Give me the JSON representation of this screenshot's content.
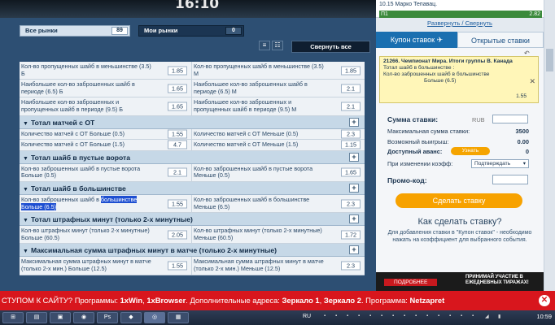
{
  "header": {
    "time": "16:10"
  },
  "filters": {
    "all_markets_label": "Все рынки",
    "all_markets_count": "89",
    "my_markets_label": "Мои рынки",
    "my_markets_count": "0",
    "collapse_all": "Свернуть все"
  },
  "markets": [
    {
      "type": "row",
      "left": {
        "text": "Кол-во пропущенных шайб в меньшинстве (3.5) Б",
        "odd": "1.85"
      },
      "right": {
        "text": "Кол-во пропущенных шайб в меньшинстве (3.5) М",
        "odd": "1.85"
      }
    },
    {
      "type": "row",
      "left": {
        "text": "Наибольшее кол-во заброшенных шайб в периоде (6.5) Б",
        "odd": "1.65"
      },
      "right": {
        "text": "Наибольшее кол-во заброшенных шайб в периоде (6.5) М",
        "odd": "2.1"
      }
    },
    {
      "type": "row",
      "left": {
        "text": "Наибольшее кол-во заброшенных и пропущенных шайб в периоде (9.5) Б",
        "odd": "1.65"
      },
      "right": {
        "text": "Наибольшее кол-во заброшенных и пропущенных шайб в периоде (9.5) М",
        "odd": "2.1"
      }
    },
    {
      "type": "section",
      "title": "Тотал матчей с ОТ"
    },
    {
      "type": "row",
      "left": {
        "text": "Количество матчей с ОТ Больше (0.5)",
        "odd": "1.55"
      },
      "right": {
        "text": "Количество матчей с ОТ Меньше (0.5)",
        "odd": "2.3"
      }
    },
    {
      "type": "row",
      "left": {
        "text": "Количество матчей с ОТ Больше (1.5)",
        "odd": "4.7"
      },
      "right": {
        "text": "Количество матчей с ОТ Меньше (1.5)",
        "odd": "1.15"
      }
    },
    {
      "type": "section",
      "title": "Тотал шайб в пустые ворота"
    },
    {
      "type": "row",
      "left": {
        "text": "Кол-во заброшенных шайб в пустые ворота Больше (0.5)",
        "odd": "2.1"
      },
      "right": {
        "text": "Кол-во заброшенных шайб в пустые ворота Меньше (0.5)",
        "odd": "1.65"
      }
    },
    {
      "type": "section",
      "title": "Тотал шайб в большинстве"
    },
    {
      "type": "row",
      "left": {
        "text": "Кол-во заброшенных шайб в большинстве Больше (6.5)",
        "odd": "1.55",
        "highlight": "большинстве Больше (6.5)"
      },
      "right": {
        "text": "Кол-во заброшенных шайб в большинстве Меньше (6.5)",
        "odd": "2.3"
      }
    },
    {
      "type": "section",
      "title": "Тотал штрафных минут (только 2-х минутные)"
    },
    {
      "type": "row",
      "left": {
        "text": "Кол-во штрафных минут (только 2-х минутные) Больше (60.5)",
        "odd": "2.05"
      },
      "right": {
        "text": "Кол-во штрафных минут (только 2-х минутные) Меньше (60.5)",
        "odd": "1.72"
      }
    },
    {
      "type": "section",
      "title": "Максимальная сумма штрафных минут в матче (только 2-х минутные)"
    },
    {
      "type": "row",
      "left": {
        "text": "Максимальная сумма штрафных минут в матче (только 2-х мин.) Больше (12.5)",
        "odd": "1.55"
      },
      "right": {
        "text": "Максимальная сумма штрафных минут в матче (только 2-х мин.) Меньше (12.5)",
        "odd": "2.3"
      }
    }
  ],
  "right_panel": {
    "live_line": "10.15 Марко Тепавац.",
    "p1_label": "П1",
    "p1_odd": "2.82",
    "links": "Развернуть / Свернуть",
    "tab_coupon": "Купон ставок",
    "tab_open": "Открытые ставки",
    "slip_title": "21266. Чемпионат Мира. Итоги группы В. Канада",
    "slip_market": "Тотал шайб в большинстве :",
    "slip_line": "Кол-во заброшенных шайб в большинстве",
    "slip_outcome": "Больше (6.5)",
    "slip_odd": "1.55",
    "stake_label": "Сумма ставки:",
    "currency": "RUB",
    "max_stake_label": "Максимальная сумма ставки:",
    "max_stake": "3500",
    "possible_win_label": "Возможный выигрыш:",
    "possible_win": "0.00",
    "advance_label": "Доступный аванс:",
    "advance_btn": "Узнать",
    "advance_val": "0",
    "odds_change_label": "При изменении коэфф:",
    "odds_change_value": "Подтверждать",
    "promo_label": "Промо-код:",
    "make_bet": "Сделать ставку",
    "how_title": "Как сделать ставку?",
    "how_desc": "Для добавления ставки в \"Купон ставок\" - необходимо нажать на коэффициент для выбранного события.",
    "ad_more": "ПОДРОБНЕЕ",
    "ad_text": "ПРИНИМАЙ УЧАСТИЕ В ЕЖЕДНЕВНЫХ ТИРАЖАХ!"
  },
  "notice": {
    "prefix": "СТУПОМ К САЙТУ? Программы: ",
    "p1": "1xWin",
    "sep1": ", ",
    "p2": "1xBrowser",
    "mid": ". Дополнительные адреса: ",
    "m1": "Зеркало 1",
    "sep2": ", ",
    "m2": "Зеркало 2",
    "tail": ". Программа: ",
    "p3": "Netzapret"
  },
  "taskbar": {
    "lang": "RU",
    "clock": "10:59",
    "ps_label": "Ps"
  }
}
